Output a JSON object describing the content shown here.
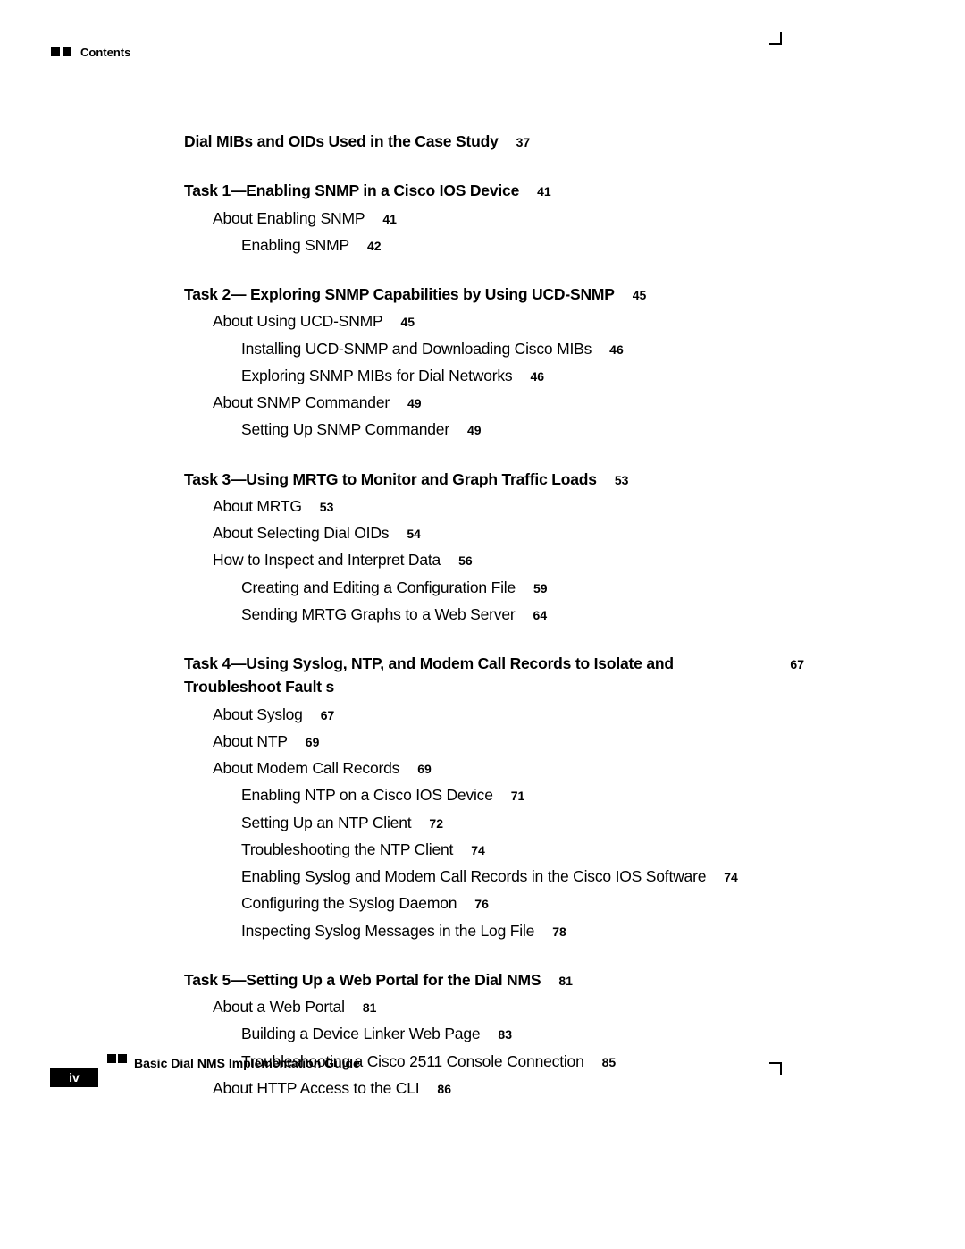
{
  "header": {
    "label": "Contents"
  },
  "footer": {
    "guide_title": "Basic Dial NMS Implementation Guide",
    "page_number": "iv"
  },
  "toc": [
    {
      "level": 0,
      "title": "Dial MIBs and OIDs Used in the Case Study",
      "page": "37"
    },
    {
      "spacer": true
    },
    {
      "level": 0,
      "title": "Task 1—Enabling SNMP in a Cisco IOS Device",
      "page": "41"
    },
    {
      "level": 1,
      "title": "About Enabling SNMP",
      "page": "41"
    },
    {
      "level": 2,
      "title": "Enabling SNMP",
      "page": "42"
    },
    {
      "spacer": true
    },
    {
      "level": 0,
      "title": "Task 2— Exploring SNMP Capabilities by Using UCD-SNMP",
      "page": "45"
    },
    {
      "level": 1,
      "title": "About Using UCD-SNMP",
      "page": "45"
    },
    {
      "level": 2,
      "title": "Installing UCD-SNMP and Downloading Cisco MIBs",
      "page": "46"
    },
    {
      "level": 2,
      "title": "Exploring SNMP MIBs for Dial Networks",
      "page": "46"
    },
    {
      "level": 1,
      "title": "About SNMP Commander",
      "page": "49"
    },
    {
      "level": 2,
      "title": "Setting Up SNMP Commander",
      "page": "49"
    },
    {
      "spacer": true
    },
    {
      "level": 0,
      "title": "Task 3—Using MRTG to Monitor and Graph Traffic Loads",
      "page": "53"
    },
    {
      "level": 1,
      "title": "About MRTG",
      "page": "53"
    },
    {
      "level": 1,
      "title": "About Selecting Dial OIDs",
      "page": "54"
    },
    {
      "level": 1,
      "title": "How to Inspect and Interpret Data",
      "page": "56"
    },
    {
      "level": 2,
      "title": "Creating and Editing a Configuration File",
      "page": "59"
    },
    {
      "level": 2,
      "title": "Sending MRTG Graphs to a Web Server",
      "page": "64"
    },
    {
      "spacer": true
    },
    {
      "level": 0,
      "title": "Task 4—Using Syslog, NTP, and Modem Call Records to Isolate and Troubleshoot Fault s",
      "page": "67"
    },
    {
      "level": 1,
      "title": "About Syslog",
      "page": "67"
    },
    {
      "level": 1,
      "title": "About NTP",
      "page": "69"
    },
    {
      "level": 1,
      "title": "About Modem Call Records",
      "page": "69"
    },
    {
      "level": 2,
      "title": "Enabling NTP on a Cisco IOS Device",
      "page": "71"
    },
    {
      "level": 2,
      "title": "Setting Up an NTP Client",
      "page": "72"
    },
    {
      "level": 2,
      "title": "Troubleshooting the NTP Client",
      "page": "74"
    },
    {
      "level": 2,
      "title": "Enabling Syslog and Modem Call Records in the Cisco IOS Software",
      "page": "74"
    },
    {
      "level": 2,
      "title": "Configuring the Syslog Daemon",
      "page": "76"
    },
    {
      "level": 2,
      "title": "Inspecting Syslog Messages in the Log File",
      "page": "78"
    },
    {
      "spacer": true
    },
    {
      "level": 0,
      "title": "Task 5—Setting Up a Web Portal for the Dial NMS",
      "page": "81"
    },
    {
      "level": 1,
      "title": "About a Web Portal",
      "page": "81"
    },
    {
      "level": 2,
      "title": "Building a Device Linker Web Page",
      "page": "83"
    },
    {
      "level": 2,
      "title": "Troubleshooting a Cisco 2511 Console Connection",
      "page": "85"
    },
    {
      "level": 1,
      "title": "About HTTP Access to the CLI",
      "page": "86"
    }
  ]
}
